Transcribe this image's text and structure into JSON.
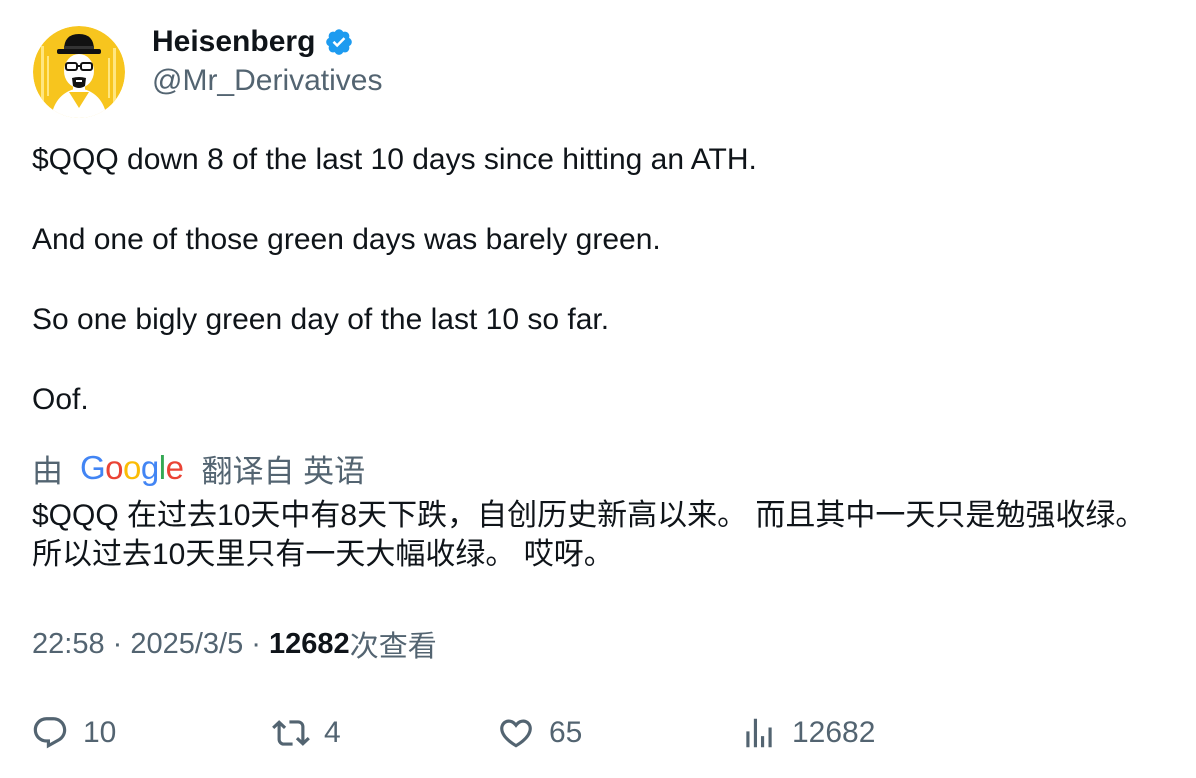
{
  "author": {
    "display_name": "Heisenberg",
    "handle": "@Mr_Derivatives",
    "verified_icon": "verified-badge-icon",
    "avatar_icon": "heisenberg-avatar",
    "colors": {
      "avatar_bg": "#f7c51e",
      "verified": "#1d9bf0"
    }
  },
  "tweet": {
    "lines": [
      "$QQQ down 8 of the last 10 days since hitting an ATH.",
      "And one of those green days was barely green.",
      "So one bigly green day of the last 10 so far.",
      "Oof."
    ]
  },
  "translation": {
    "by_label": "由",
    "provider": "Google",
    "from_label": "翻译自 英语",
    "text": "$QQQ 在过去10天中有8天下跌，自创历史新高以来。 而且其中一天只是勉强收绿。 所以过去10天里只有一天大幅收绿。 哎呀。"
  },
  "meta": {
    "time": "22:58",
    "separator": " · ",
    "date": "2025/3/5",
    "views_count": "12682",
    "views_label": "次查看"
  },
  "actions": {
    "reply": {
      "icon": "reply-icon",
      "count": "10"
    },
    "retweet": {
      "icon": "retweet-icon",
      "count": "4"
    },
    "like": {
      "icon": "heart-icon",
      "count": "65"
    },
    "views": {
      "icon": "views-icon",
      "count": "12682"
    }
  },
  "colors": {
    "text_primary": "#0f1419",
    "text_secondary": "#536471",
    "background": "#ffffff"
  }
}
